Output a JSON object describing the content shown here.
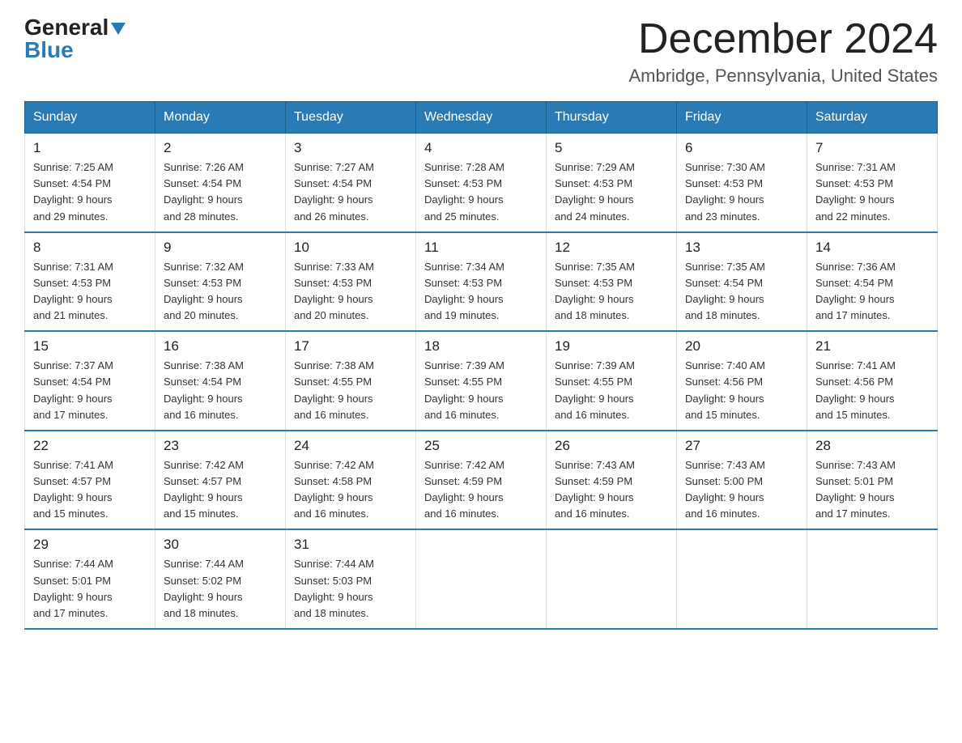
{
  "header": {
    "logo_general": "General",
    "logo_blue": "Blue",
    "month_title": "December 2024",
    "location": "Ambridge, Pennsylvania, United States"
  },
  "days_of_week": [
    "Sunday",
    "Monday",
    "Tuesday",
    "Wednesday",
    "Thursday",
    "Friday",
    "Saturday"
  ],
  "weeks": [
    [
      {
        "day": "1",
        "sunrise": "Sunrise: 7:25 AM",
        "sunset": "Sunset: 4:54 PM",
        "daylight": "Daylight: 9 hours",
        "daylight2": "and 29 minutes."
      },
      {
        "day": "2",
        "sunrise": "Sunrise: 7:26 AM",
        "sunset": "Sunset: 4:54 PM",
        "daylight": "Daylight: 9 hours",
        "daylight2": "and 28 minutes."
      },
      {
        "day": "3",
        "sunrise": "Sunrise: 7:27 AM",
        "sunset": "Sunset: 4:54 PM",
        "daylight": "Daylight: 9 hours",
        "daylight2": "and 26 minutes."
      },
      {
        "day": "4",
        "sunrise": "Sunrise: 7:28 AM",
        "sunset": "Sunset: 4:53 PM",
        "daylight": "Daylight: 9 hours",
        "daylight2": "and 25 minutes."
      },
      {
        "day": "5",
        "sunrise": "Sunrise: 7:29 AM",
        "sunset": "Sunset: 4:53 PM",
        "daylight": "Daylight: 9 hours",
        "daylight2": "and 24 minutes."
      },
      {
        "day": "6",
        "sunrise": "Sunrise: 7:30 AM",
        "sunset": "Sunset: 4:53 PM",
        "daylight": "Daylight: 9 hours",
        "daylight2": "and 23 minutes."
      },
      {
        "day": "7",
        "sunrise": "Sunrise: 7:31 AM",
        "sunset": "Sunset: 4:53 PM",
        "daylight": "Daylight: 9 hours",
        "daylight2": "and 22 minutes."
      }
    ],
    [
      {
        "day": "8",
        "sunrise": "Sunrise: 7:31 AM",
        "sunset": "Sunset: 4:53 PM",
        "daylight": "Daylight: 9 hours",
        "daylight2": "and 21 minutes."
      },
      {
        "day": "9",
        "sunrise": "Sunrise: 7:32 AM",
        "sunset": "Sunset: 4:53 PM",
        "daylight": "Daylight: 9 hours",
        "daylight2": "and 20 minutes."
      },
      {
        "day": "10",
        "sunrise": "Sunrise: 7:33 AM",
        "sunset": "Sunset: 4:53 PM",
        "daylight": "Daylight: 9 hours",
        "daylight2": "and 20 minutes."
      },
      {
        "day": "11",
        "sunrise": "Sunrise: 7:34 AM",
        "sunset": "Sunset: 4:53 PM",
        "daylight": "Daylight: 9 hours",
        "daylight2": "and 19 minutes."
      },
      {
        "day": "12",
        "sunrise": "Sunrise: 7:35 AM",
        "sunset": "Sunset: 4:53 PM",
        "daylight": "Daylight: 9 hours",
        "daylight2": "and 18 minutes."
      },
      {
        "day": "13",
        "sunrise": "Sunrise: 7:35 AM",
        "sunset": "Sunset: 4:54 PM",
        "daylight": "Daylight: 9 hours",
        "daylight2": "and 18 minutes."
      },
      {
        "day": "14",
        "sunrise": "Sunrise: 7:36 AM",
        "sunset": "Sunset: 4:54 PM",
        "daylight": "Daylight: 9 hours",
        "daylight2": "and 17 minutes."
      }
    ],
    [
      {
        "day": "15",
        "sunrise": "Sunrise: 7:37 AM",
        "sunset": "Sunset: 4:54 PM",
        "daylight": "Daylight: 9 hours",
        "daylight2": "and 17 minutes."
      },
      {
        "day": "16",
        "sunrise": "Sunrise: 7:38 AM",
        "sunset": "Sunset: 4:54 PM",
        "daylight": "Daylight: 9 hours",
        "daylight2": "and 16 minutes."
      },
      {
        "day": "17",
        "sunrise": "Sunrise: 7:38 AM",
        "sunset": "Sunset: 4:55 PM",
        "daylight": "Daylight: 9 hours",
        "daylight2": "and 16 minutes."
      },
      {
        "day": "18",
        "sunrise": "Sunrise: 7:39 AM",
        "sunset": "Sunset: 4:55 PM",
        "daylight": "Daylight: 9 hours",
        "daylight2": "and 16 minutes."
      },
      {
        "day": "19",
        "sunrise": "Sunrise: 7:39 AM",
        "sunset": "Sunset: 4:55 PM",
        "daylight": "Daylight: 9 hours",
        "daylight2": "and 16 minutes."
      },
      {
        "day": "20",
        "sunrise": "Sunrise: 7:40 AM",
        "sunset": "Sunset: 4:56 PM",
        "daylight": "Daylight: 9 hours",
        "daylight2": "and 15 minutes."
      },
      {
        "day": "21",
        "sunrise": "Sunrise: 7:41 AM",
        "sunset": "Sunset: 4:56 PM",
        "daylight": "Daylight: 9 hours",
        "daylight2": "and 15 minutes."
      }
    ],
    [
      {
        "day": "22",
        "sunrise": "Sunrise: 7:41 AM",
        "sunset": "Sunset: 4:57 PM",
        "daylight": "Daylight: 9 hours",
        "daylight2": "and 15 minutes."
      },
      {
        "day": "23",
        "sunrise": "Sunrise: 7:42 AM",
        "sunset": "Sunset: 4:57 PM",
        "daylight": "Daylight: 9 hours",
        "daylight2": "and 15 minutes."
      },
      {
        "day": "24",
        "sunrise": "Sunrise: 7:42 AM",
        "sunset": "Sunset: 4:58 PM",
        "daylight": "Daylight: 9 hours",
        "daylight2": "and 16 minutes."
      },
      {
        "day": "25",
        "sunrise": "Sunrise: 7:42 AM",
        "sunset": "Sunset: 4:59 PM",
        "daylight": "Daylight: 9 hours",
        "daylight2": "and 16 minutes."
      },
      {
        "day": "26",
        "sunrise": "Sunrise: 7:43 AM",
        "sunset": "Sunset: 4:59 PM",
        "daylight": "Daylight: 9 hours",
        "daylight2": "and 16 minutes."
      },
      {
        "day": "27",
        "sunrise": "Sunrise: 7:43 AM",
        "sunset": "Sunset: 5:00 PM",
        "daylight": "Daylight: 9 hours",
        "daylight2": "and 16 minutes."
      },
      {
        "day": "28",
        "sunrise": "Sunrise: 7:43 AM",
        "sunset": "Sunset: 5:01 PM",
        "daylight": "Daylight: 9 hours",
        "daylight2": "and 17 minutes."
      }
    ],
    [
      {
        "day": "29",
        "sunrise": "Sunrise: 7:44 AM",
        "sunset": "Sunset: 5:01 PM",
        "daylight": "Daylight: 9 hours",
        "daylight2": "and 17 minutes."
      },
      {
        "day": "30",
        "sunrise": "Sunrise: 7:44 AM",
        "sunset": "Sunset: 5:02 PM",
        "daylight": "Daylight: 9 hours",
        "daylight2": "and 18 minutes."
      },
      {
        "day": "31",
        "sunrise": "Sunrise: 7:44 AM",
        "sunset": "Sunset: 5:03 PM",
        "daylight": "Daylight: 9 hours",
        "daylight2": "and 18 minutes."
      },
      {
        "day": "",
        "sunrise": "",
        "sunset": "",
        "daylight": "",
        "daylight2": ""
      },
      {
        "day": "",
        "sunrise": "",
        "sunset": "",
        "daylight": "",
        "daylight2": ""
      },
      {
        "day": "",
        "sunrise": "",
        "sunset": "",
        "daylight": "",
        "daylight2": ""
      },
      {
        "day": "",
        "sunrise": "",
        "sunset": "",
        "daylight": "",
        "daylight2": ""
      }
    ]
  ]
}
